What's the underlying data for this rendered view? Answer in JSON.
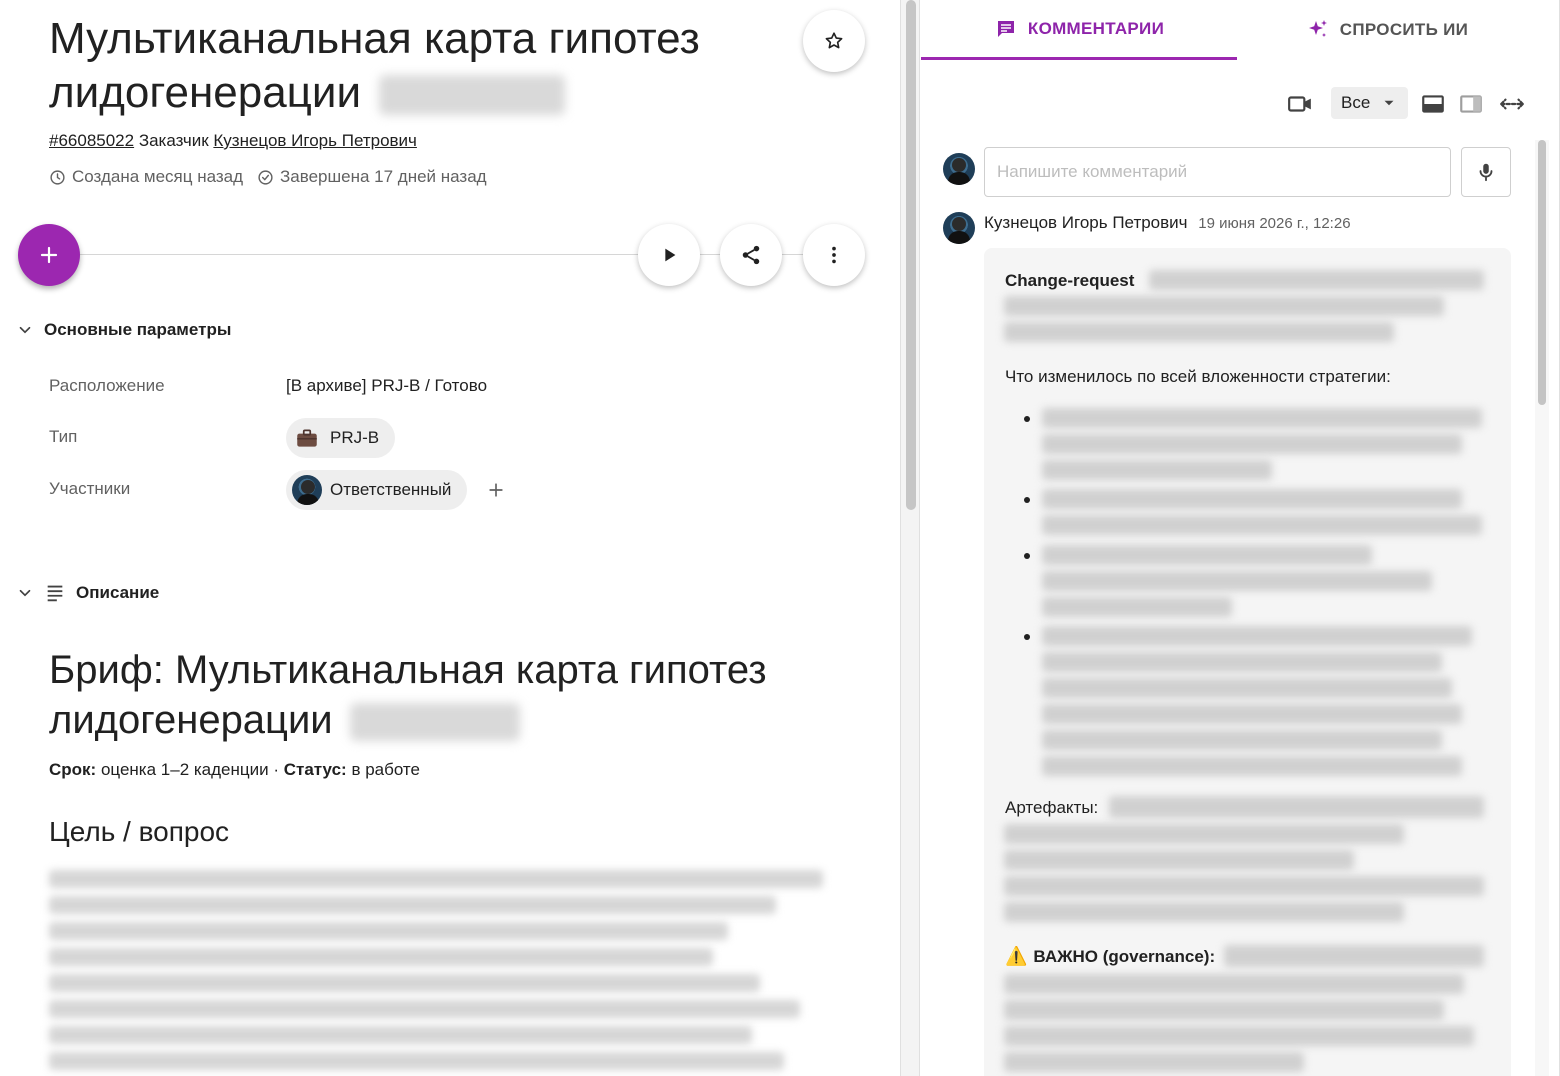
{
  "task": {
    "title": "Мультиканальная карта гипотез лидогенерации",
    "id": "#66085022",
    "customer_label": "Заказчик",
    "customer_name": "Кузнецов Игорь Петрович",
    "created": "Создана месяц назад",
    "completed": "Завершена 17 дней назад"
  },
  "sections": {
    "main_params": "Основные параметры",
    "description": "Описание"
  },
  "params": {
    "location_label": "Расположение",
    "location_value": "[В архиве] PRJ-B / Готово",
    "type_label": "Тип",
    "type_value": "PRJ-B",
    "members_label": "Участники",
    "members_value": "Ответственный"
  },
  "brief": {
    "title": "Бриф: Мультиканальная карта гипотез лидогенерации",
    "deadline_label": "Срок:",
    "deadline_value": "оценка 1–2 каденции ·",
    "status_label": "Статус:",
    "status_value": "в работе",
    "goal_heading": "Цель / вопрос"
  },
  "panel": {
    "tab_comments": "КОММЕНТАРИИ",
    "tab_ai": "СПРОСИТЬ ИИ",
    "filter_value": "Все",
    "comment_placeholder": "Напишите комментарий"
  },
  "comment": {
    "author": "Кузнецов Игорь Петрович",
    "timestamp": "19 июня 2026 г., 12:26",
    "change_request_label": "Change-request",
    "changes_heading": "Что изменилось по всей вложенности стратегии:",
    "artifacts_label": "Артефакты:",
    "important_label": "ВАЖНО (governance):",
    "warning_glyph": "⚠️"
  },
  "colors": {
    "accent": "#9c27b0",
    "accent_text": "#8e24aa"
  }
}
